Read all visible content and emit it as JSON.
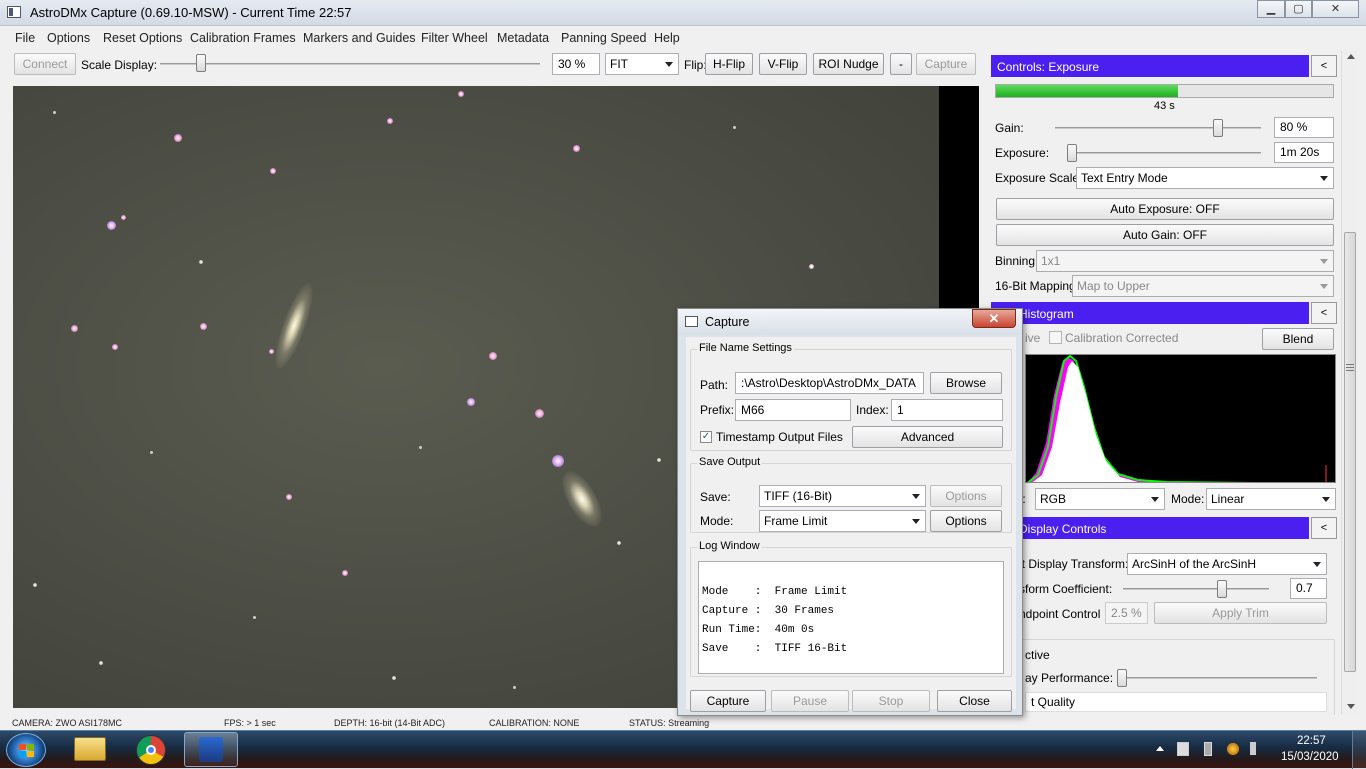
{
  "window": {
    "title": "AstroDMx Capture (0.69.10-MSW) - Current Time 22:57",
    "min_label": "▁",
    "max_label": "▢",
    "close_label": "✕"
  },
  "menu": [
    "File",
    "Options",
    "Reset Options",
    "Calibration Frames",
    "Markers and Guides",
    "Filter Wheel",
    "Metadata",
    "Panning Speed",
    "Help"
  ],
  "toolbar": {
    "connect_label": "Connect",
    "scale_label": "Scale Display:",
    "scale_value": "30 %",
    "fit_value": "FIT",
    "flip_label": "Flip:",
    "hflip_label": "H-Flip",
    "vflip_label": "V-Flip",
    "roi_label": "ROI Nudge",
    "dash_label": "-",
    "capture_label": "Capture"
  },
  "status": {
    "camera": "CAMERA: ZWO ASI178MC",
    "fps": "FPS: > 1 sec",
    "depth": "DEPTH: 16-bit  (14-Bit ADC)",
    "calibration": "CALIBRATION: NONE",
    "status": "STATUS: Streaming"
  },
  "exposure_panel": {
    "header": "Controls: Exposure",
    "collapse_label": "<",
    "progress_percent": 54,
    "progress_text": "43 s",
    "gain_label": "Gain:",
    "gain_value": "80 %",
    "exposure_label": "Exposure:",
    "exposure_value": "1m 20s",
    "scale_label": "Exposure Scale:",
    "scale_value": "Text Entry Mode",
    "auto_exposure": "Auto Exposure: OFF",
    "auto_gain": "Auto Gain: OFF",
    "binning_label": "Binning:",
    "binning_value": "1x1",
    "mapping_label": "16-Bit Mapping:",
    "mapping_value": "Map to Upper"
  },
  "histogram_panel": {
    "header": "ols: Histogram",
    "collapse_label": "<",
    "live_label": "ive",
    "calib_label": "Calibration Corrected",
    "blend_label": "Blend",
    "channel_label": "el:",
    "channel_value": "RGB",
    "mode_label": "Mode:",
    "mode_value": "Linear"
  },
  "display_panel": {
    "header": "ols: Display Controls",
    "collapse_label": "<",
    "transform_label": "it Display Transform:",
    "transform_value": "ArcSinH of the ArcSinH",
    "coef_label": "sform Coefficient:",
    "coef_value": "0.7",
    "endpoint_label": "ndpoint Control",
    "endpoint_value": "2.5 %",
    "apply_trim": "Apply Trim",
    "active_label": "ctive",
    "perf_label": "ay Performance:",
    "quality_label": "t Quality"
  },
  "capture_dialog": {
    "title": "Capture",
    "close_icon": "✕",
    "file_group": "File Name Settings",
    "path_label": "Path:",
    "path_value": ":\\Astro\\Desktop\\AstroDMx_DATA",
    "browse_label": "Browse",
    "prefix_label": "Prefix:",
    "prefix_value": "M66",
    "index_label": "Index:",
    "index_value": "1",
    "timestamp_label": "Timestamp Output Files",
    "advanced_label": "Advanced",
    "save_group": "Save Output",
    "save_label": "Save:",
    "save_value": "TIFF (16-Bit)",
    "save_options": "Options",
    "mode_label": "Mode:",
    "mode_value": "Frame Limit",
    "mode_options": "Options",
    "log_group": "Log Window",
    "log_lines": [
      "Mode    :  Frame Limit",
      "Capture :  30 Frames",
      "Run Time:  40m 0s",
      "Save    :  TIFF 16-Bit"
    ],
    "capture_btn": "Capture",
    "pause_btn": "Pause",
    "stop_btn": "Stop",
    "close_btn": "Close"
  },
  "taskbar": {
    "time": "22:57",
    "date": "15/03/2020"
  }
}
